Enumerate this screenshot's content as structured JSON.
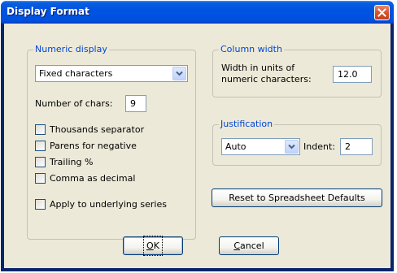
{
  "window": {
    "title": "Display Format"
  },
  "numeric_display": {
    "label": "Numeric display",
    "format_select": {
      "value": "Fixed characters"
    },
    "num_chars_label": "Number of chars:",
    "num_chars_value": "9",
    "checkboxes": [
      {
        "label": "Thousands separator",
        "checked": false
      },
      {
        "label": "Parens for negative",
        "checked": false
      },
      {
        "label": "Trailing %",
        "checked": false
      },
      {
        "label": "Comma as decimal",
        "checked": false
      }
    ],
    "apply_underlying": {
      "label": "Apply to underlying series",
      "checked": false
    }
  },
  "column_width": {
    "label": "Column width",
    "caption_line1": "Width in units of",
    "caption_line2": "numeric characters:",
    "value": "12.0"
  },
  "justification": {
    "label": "Justification",
    "select_value": "Auto",
    "indent_label": "Indent:",
    "indent_value": "2"
  },
  "buttons": {
    "reset": "Reset to Spreadsheet Defaults",
    "ok_mnemonic": "O",
    "ok_rest": "K",
    "cancel_mnemonic": "C",
    "cancel_rest": "ancel"
  },
  "colors": {
    "title_bar": "#0054e3",
    "group_label": "#0046d5",
    "dialog_face": "#ece9d8",
    "close_button": "#d9532a"
  },
  "icons": {
    "close": "close-x-icon",
    "dropdown": "chevron-down-icon"
  }
}
